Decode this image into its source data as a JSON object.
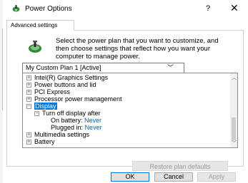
{
  "window": {
    "title": "Power Options",
    "help_label": "?",
    "close_label": "✕"
  },
  "tab": {
    "label": "Advanced settings"
  },
  "intro": {
    "line1": "Select the power plan that you want to customize, and",
    "line2": "then choose settings that reflect how you want your",
    "line3": "computer to manage power."
  },
  "plan_select": {
    "value": "My Custom Plan 1 [Active]"
  },
  "tree": {
    "items": [
      {
        "label": "Intel(R) Graphics Settings",
        "expander": "+"
      },
      {
        "label": "Power buttons and lid",
        "expander": "+"
      },
      {
        "label": "PCI Express",
        "expander": "+"
      },
      {
        "label": "Processor power management",
        "expander": "+"
      },
      {
        "label": "Display",
        "expander": "−"
      },
      {
        "label": "Turn off display after",
        "expander": "−"
      },
      {
        "label": "On battery:",
        "value": "Never"
      },
      {
        "label": "Plugged in:",
        "value": "Never"
      },
      {
        "label": "Multimedia settings",
        "expander": "+"
      },
      {
        "label": "Battery",
        "expander": "+"
      }
    ]
  },
  "buttons": {
    "restore": "Restore plan defaults",
    "ok": "OK",
    "cancel": "Cancel",
    "apply": "Apply"
  },
  "colors": {
    "selection": "#0078d7",
    "link": "#0066cc"
  }
}
